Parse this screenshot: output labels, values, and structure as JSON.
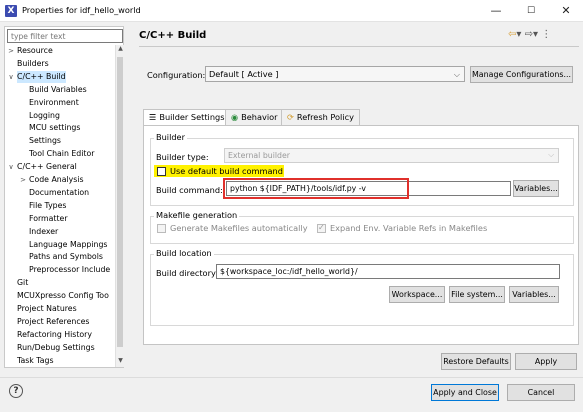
{
  "window": {
    "title": "Properties for idf_hello_world",
    "minimize": "—",
    "maximize": "☐",
    "close": "✕"
  },
  "left": {
    "filter_placeholder": "type filter text",
    "items": [
      {
        "label": "Resource",
        "toggle": ">"
      },
      {
        "label": "Builders",
        "toggle": ""
      },
      {
        "label": "C/C++ Build",
        "toggle": "∨"
      },
      {
        "label": "Build Variables",
        "toggle": ""
      },
      {
        "label": "Environment",
        "toggle": ""
      },
      {
        "label": "Logging",
        "toggle": ""
      },
      {
        "label": "MCU settings",
        "toggle": ""
      },
      {
        "label": "Settings",
        "toggle": ""
      },
      {
        "label": "Tool Chain Editor",
        "toggle": ""
      },
      {
        "label": "C/C++ General",
        "toggle": "∨"
      },
      {
        "label": "Code Analysis",
        "toggle": ">"
      },
      {
        "label": "Documentation",
        "toggle": ""
      },
      {
        "label": "File Types",
        "toggle": ""
      },
      {
        "label": "Formatter",
        "toggle": ""
      },
      {
        "label": "Indexer",
        "toggle": ""
      },
      {
        "label": "Language Mappings",
        "toggle": ""
      },
      {
        "label": "Paths and Symbols",
        "toggle": ""
      },
      {
        "label": "Preprocessor Include",
        "toggle": ""
      },
      {
        "label": "Git",
        "toggle": ""
      },
      {
        "label": "MCUXpresso Config Too",
        "toggle": ""
      },
      {
        "label": "Project Natures",
        "toggle": ""
      },
      {
        "label": "Project References",
        "toggle": ""
      },
      {
        "label": "Refactoring History",
        "toggle": ""
      },
      {
        "label": "Run/Debug Settings",
        "toggle": ""
      },
      {
        "label": "Task Tags",
        "toggle": ""
      }
    ]
  },
  "main": {
    "title": "C/C++ Build",
    "nav": {
      "back": "⇦",
      "back_menu": "▾",
      "fwd": "⇨",
      "fwd_menu": "▾",
      "menu": "⋮"
    },
    "configuration_label": "Configuration:",
    "configuration_value": "Default  [ Active ]",
    "manage_button": "Manage Configurations...",
    "tabs": [
      {
        "label": "Builder Settings",
        "icon": "☰"
      },
      {
        "label": "Behavior",
        "icon": "◉"
      },
      {
        "label": "Refresh Policy",
        "icon": "⟳"
      }
    ],
    "builder": {
      "group": "Builder",
      "type_label": "Builder type:",
      "type_value": "External builder",
      "use_default_label": "Use default build command",
      "command_label": "Build command:",
      "command_value": "python ${IDF_PATH}/tools/idf.py -v",
      "variables_button": "Variables..."
    },
    "makefile": {
      "group": "Makefile generation",
      "generate_label": "Generate Makefiles automatically",
      "expand_label": "Expand Env. Variable Refs in Makefiles"
    },
    "location": {
      "group": "Build location",
      "dir_label": "Build directory:",
      "dir_value": "${workspace_loc:/idf_hello_world}/",
      "workspace_button": "Workspace...",
      "filesystem_button": "File system...",
      "variables_button": "Variables..."
    },
    "restore_button": "Restore Defaults",
    "apply_button": "Apply"
  },
  "footer": {
    "help": "?",
    "apply_close": "Apply and Close",
    "cancel": "Cancel"
  },
  "colors": {
    "highlight_yellow": "#fff200",
    "highlight_red": "#e0302b",
    "selection": "#cce8ff",
    "title_icon": "#3b4bb0"
  }
}
